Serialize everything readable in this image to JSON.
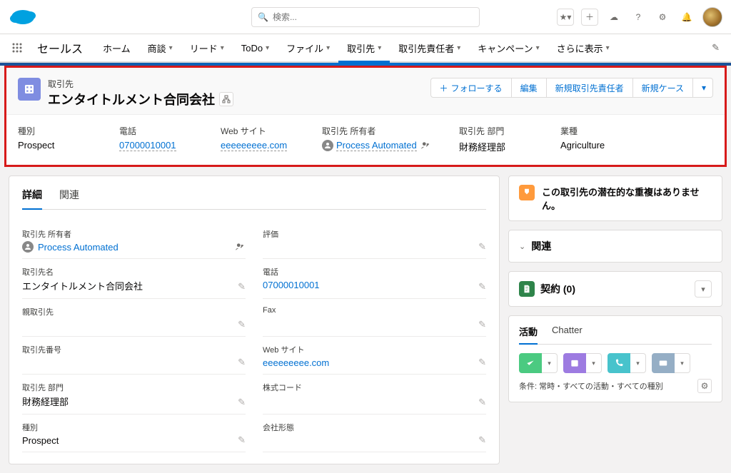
{
  "header": {
    "search_placeholder": "検索...",
    "app_name": "セールス"
  },
  "nav": {
    "tabs": [
      {
        "label": "ホーム",
        "chev": false
      },
      {
        "label": "商談",
        "chev": true
      },
      {
        "label": "リード",
        "chev": true
      },
      {
        "label": "ToDo",
        "chev": true
      },
      {
        "label": "ファイル",
        "chev": true
      },
      {
        "label": "取引先",
        "chev": true,
        "active": true
      },
      {
        "label": "取引先責任者",
        "chev": true
      },
      {
        "label": "キャンペーン",
        "chev": true
      },
      {
        "label": "さらに表示",
        "chev": true
      }
    ]
  },
  "record": {
    "object_label": "取引先",
    "name": "エンタイトルメント合同会社",
    "actions": {
      "follow": "フォローする",
      "edit": "編集",
      "new_contact": "新規取引先責任者",
      "new_case": "新規ケース"
    },
    "compact": {
      "type_label": "種別",
      "type_value": "Prospect",
      "phone_label": "電話",
      "phone_value": "07000010001",
      "website_label": "Web サイト",
      "website_value": "eeeeeeeee.com",
      "owner_label": "取引先 所有者",
      "owner_value": "Process Automated",
      "dept_label": "取引先 部門",
      "dept_value": "財務経理部",
      "industry_label": "業種",
      "industry_value": "Agriculture"
    }
  },
  "detail": {
    "tabs": {
      "detail": "詳細",
      "related": "関連"
    },
    "fields": {
      "owner_label": "取引先 所有者",
      "owner_value": "Process Automated",
      "rating_label": "評価",
      "name_label": "取引先名",
      "name_value": "エンタイトルメント合同会社",
      "phone_label": "電話",
      "phone_value": "07000010001",
      "parent_label": "親取引先",
      "fax_label": "Fax",
      "number_label": "取引先番号",
      "website_label": "Web サイト",
      "website_value": "eeeeeeeee.com",
      "dept_label": "取引先 部門",
      "dept_value": "財務経理部",
      "ticker_label": "株式コード",
      "type_label": "種別",
      "type_value": "Prospect",
      "form_label": "会社形態"
    }
  },
  "right": {
    "dup_text": "この取引先の潜在的な重複はありません。",
    "related_head": "関連",
    "contracts_label": "契約 (0)",
    "activity_tab": "活動",
    "chatter_tab": "Chatter",
    "filter_text": "条件: 常時・すべての活動・すべての種別"
  }
}
